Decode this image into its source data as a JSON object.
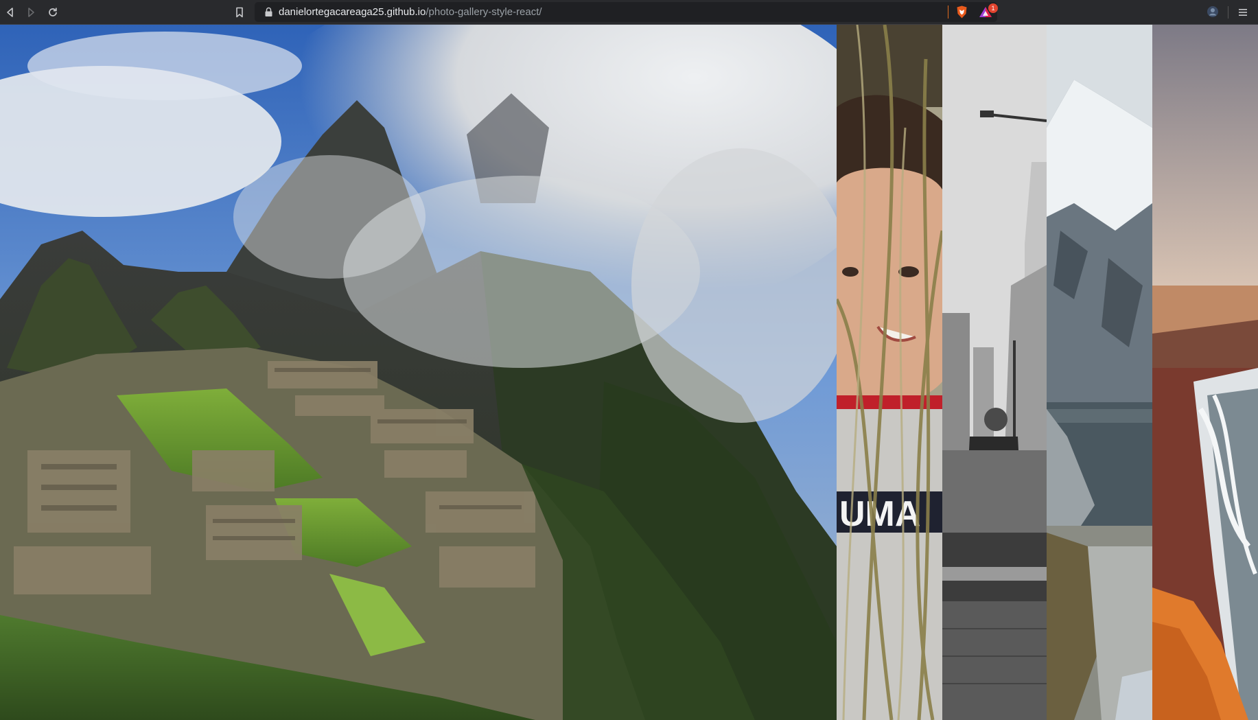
{
  "browser": {
    "url_domain": "danielortegacareaga25.github.io",
    "url_path": "/photo-gallery-style-react/",
    "rewards_count": "1",
    "icons": [
      "back-icon",
      "forward-icon",
      "reload-icon",
      "bookmark-icon",
      "lock-icon",
      "brave-shield-icon",
      "brave-rewards-icon",
      "profile-icon",
      "menu-icon"
    ]
  },
  "gallery": {
    "active_index": 0,
    "photos": [
      {
        "subject": "mountain-ruins"
      },
      {
        "subject": "portrait-woman"
      },
      {
        "subject": "city-street"
      },
      {
        "subject": "snowy-cliff-lake"
      },
      {
        "subject": "beach-coast"
      }
    ]
  },
  "colors": {
    "toolbar": "#292a2d",
    "urlbar": "#1f2023",
    "accent": "#e06b1f"
  }
}
